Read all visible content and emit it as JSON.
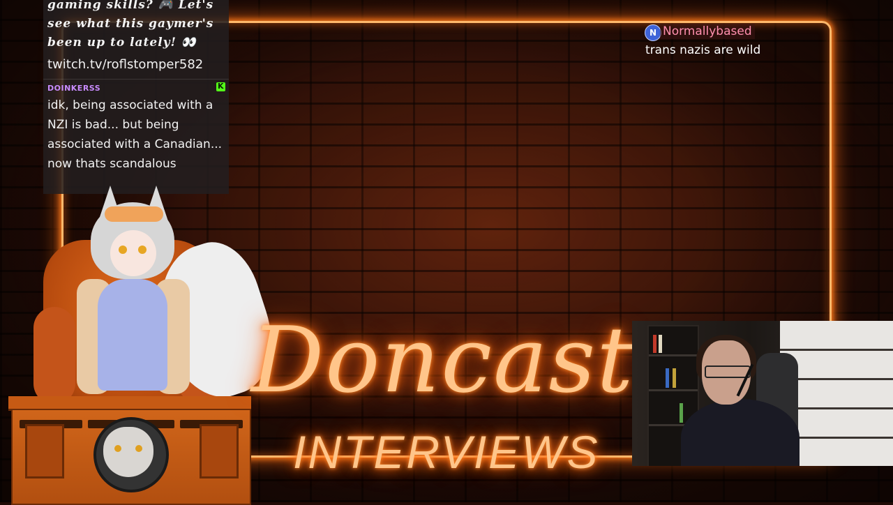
{
  "chat_overlay": {
    "message_1": {
      "text_lines": [
        "gaming skills? 🎮 Let's",
        "see what this gaymer's",
        "been up to lately! 👀"
      ],
      "link": "twitch.tv/roflstomper582"
    },
    "message_2": {
      "username": "DOINKERSS",
      "platform_icon": "kick-icon",
      "text": "idk, being associated with a NZI is bad... but being associated with a Canadian... now thats scandalous"
    }
  },
  "top_right_chat": {
    "avatar_letter": "N",
    "username": "Normallybased",
    "text": "trans nazis are wild"
  },
  "title": {
    "main": "Doncast",
    "sub": "INTERVIEWS"
  },
  "colors": {
    "neon": "#ffb86b",
    "neon_glow": "#ff7a1a",
    "username_purple": "#c98cff",
    "username_pink": "#ff8fae",
    "kick_green": "#53fc18"
  }
}
